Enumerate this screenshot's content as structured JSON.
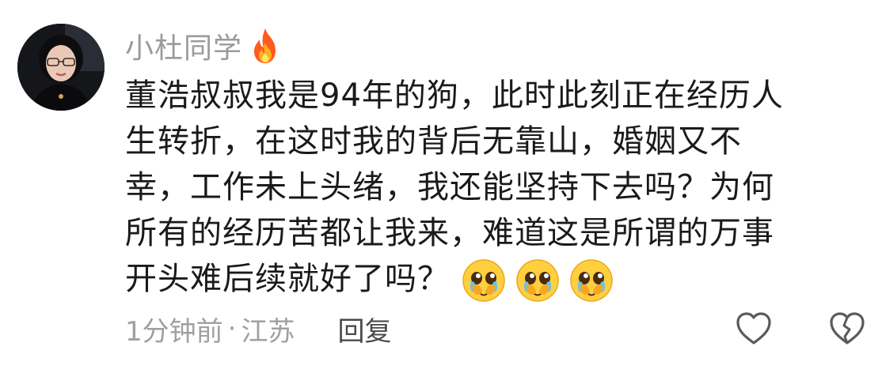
{
  "comment": {
    "username": "小杜同学",
    "badge_icon": "fire-icon",
    "text_lines": [
      "董浩叔叔我是94年的狗，此时此刻正在经历人",
      "生转折，在这时我的背后无靠山，婚姻又不",
      "幸，工作未上头绪，我还能坚持下去吗？为何",
      "所有的经历苦都让我来，难道这是所谓的万事",
      "开头难后续就好了吗？"
    ],
    "emojis": [
      "pleading-face-icon",
      "pleading-face-icon",
      "pleading-face-icon"
    ],
    "timestamp": "1分钟前",
    "separator": "·",
    "location": "江苏",
    "reply_label": "回复",
    "like_icon": "heart-outline-icon",
    "dislike_icon": "broken-heart-icon"
  },
  "colors": {
    "username": "#9a9a9a",
    "text": "#1a1a1a",
    "meta": "#a0a0a0",
    "reply": "#4a4a4a"
  }
}
